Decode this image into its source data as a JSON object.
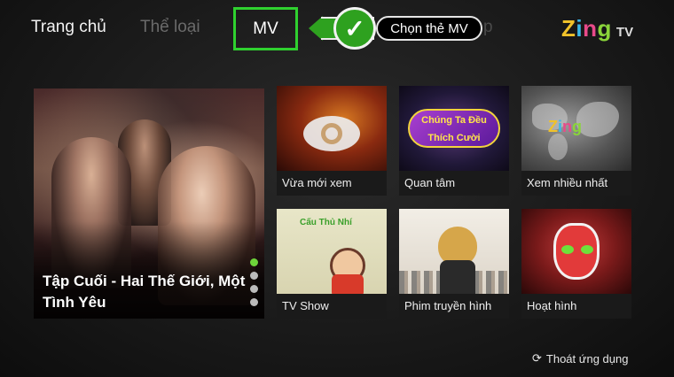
{
  "nav": {
    "home": "Trang chủ",
    "genre": "Thể loại",
    "mv": "MV",
    "partial_hidden": "p"
  },
  "callout": {
    "check_icon": "check-circle-icon",
    "label": "Chọn thẻ MV",
    "color": "#2ea11f"
  },
  "logo": {
    "brand": "Zing",
    "suffix": "TV"
  },
  "hero": {
    "title": "Tập Cuối - Hai Thế Giới, Một Tình Yêu",
    "page_dots": 4,
    "active_dot": 1
  },
  "tiles": [
    {
      "label": "Vừa mới xem",
      "icon": "eye-icon"
    },
    {
      "label": "Quan tâm",
      "image_text": "Chúng Ta Đều Thích Cười"
    },
    {
      "label": "Xem nhiều nhất",
      "image_text": "Zing"
    },
    {
      "label": "TV Show",
      "image_text": "Cấu Thủ Nhí"
    },
    {
      "label": "Phim truyền hình"
    },
    {
      "label": "Hoạt hình"
    }
  ],
  "footer": {
    "exit_icon": "refresh-icon",
    "exit_label": "Thoát ứng dụng"
  },
  "colors": {
    "accent": "#2fd12f",
    "background": "#1a1a1a"
  }
}
